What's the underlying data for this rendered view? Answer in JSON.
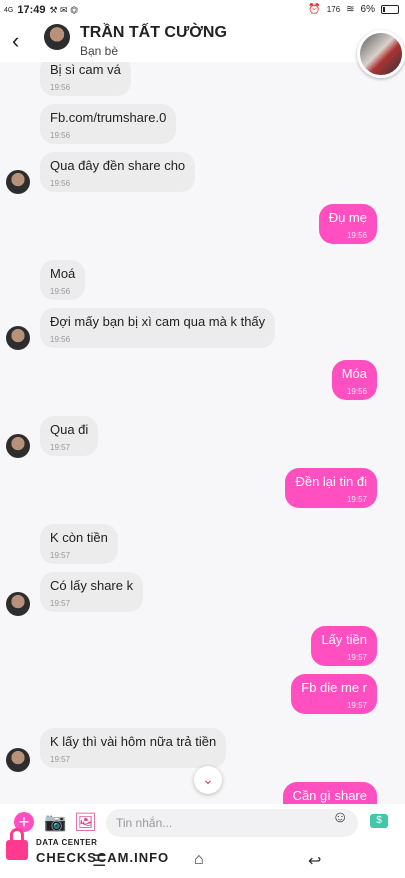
{
  "status_bar": {
    "time": "17:49",
    "signal": "4G",
    "icons": "⚒ ✉ ⏣",
    "alarm": "⏰",
    "data_speed": "176",
    "battery": "6%"
  },
  "header": {
    "name": "TRẦN TẤT CƯỜNG",
    "subtitle": "Bạn bè",
    "back_icon": "‹"
  },
  "messages": [
    {
      "dir": "in",
      "text": "Bị sì cam vá",
      "time": "19:56",
      "avatar": false
    },
    {
      "dir": "in",
      "text": "Fb.com/trumshare.0",
      "time": "19:56",
      "avatar": false
    },
    {
      "dir": "in",
      "text": "Qua đây đền share cho",
      "time": "19:56",
      "avatar": true
    },
    {
      "dir": "out",
      "text": "Đụ mẹ",
      "time": "19:56"
    },
    {
      "dir": "in",
      "text": "Moá",
      "time": "19:56",
      "avatar": false
    },
    {
      "dir": "in",
      "text": "Đợi mấy bạn bị xì cam qua mà k thấy",
      "time": "19:56",
      "avatar": true
    },
    {
      "dir": "out",
      "text": "Móa",
      "time": "19:56"
    },
    {
      "dir": "in",
      "text": "Qua đi",
      "time": "19:57",
      "avatar": true
    },
    {
      "dir": "out",
      "text": "Đền lại tin đi",
      "time": "19:57"
    },
    {
      "dir": "in",
      "text": "K còn tiền",
      "time": "19:57",
      "avatar": false
    },
    {
      "dir": "in",
      "text": "Có lấy share k",
      "time": "19:57",
      "avatar": true
    },
    {
      "dir": "out",
      "text": "Lấy tiền",
      "time": "19:57"
    },
    {
      "dir": "out",
      "text": "Fb die me r",
      "time": "19:57"
    },
    {
      "dir": "in",
      "text": "K lấy thì vài hôm nữa trả tiền",
      "time": "19:57",
      "avatar": true
    },
    {
      "dir": "out",
      "text": "Cần gì share",
      "time": ""
    }
  ],
  "input": {
    "placeholder": "Tin nhắn..."
  },
  "scroll_icon": "⌄",
  "icons": {
    "plus": "+",
    "camera": "📷",
    "image": "🖼",
    "emoji": "☺",
    "money": "$"
  },
  "nav": {
    "menu": "☰",
    "home": "⌂",
    "back": "↩"
  },
  "watermark": {
    "top": "DATA CENTER",
    "main": "CHECKSCAM.INFO"
  },
  "colors": {
    "outgoing": "#ff4fc1",
    "incoming": "#ececec",
    "accent": "#e23c8a"
  }
}
